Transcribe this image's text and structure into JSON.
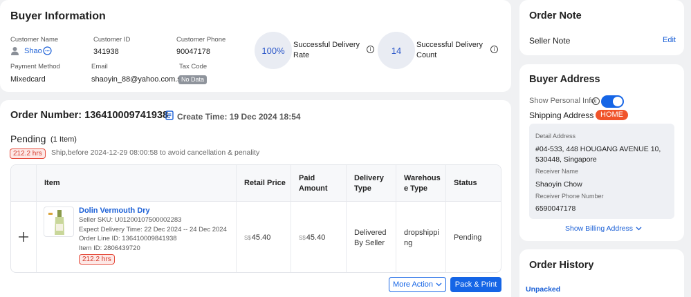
{
  "buyer_info": {
    "title": "Buyer Information",
    "customer_name_label": "Customer Name",
    "customer_name": "Shao",
    "customer_id_label": "Customer ID",
    "customer_id": "341938",
    "customer_phone_label": "Customer Phone",
    "customer_phone": "90047178",
    "delivery_rate_value": "100%",
    "delivery_rate_label_1": "Successful Delivery",
    "delivery_rate_label_2": "Rate",
    "delivery_count_value": "14",
    "delivery_count_label_1": "Successful Delivery",
    "delivery_count_label_2": "Count",
    "payment_method_label": "Payment Method",
    "payment_method": "Mixedcard",
    "email_label": "Email",
    "email": "shaoyin_88@yahoo.com.sg",
    "tax_code_label": "Tax Code",
    "tax_code": "No Data"
  },
  "order": {
    "number_label": "Order Number: 136410009741938",
    "create_time": "Create Time: 19 Dec 2024 18:54",
    "status_title": "Pending",
    "item_count": "(1 Item)",
    "warn_badge": "212.2 hrs",
    "warn_text": "Ship,before 2024-12-29 08:00:58 to avoid cancellation & penality",
    "columns": {
      "item": "Item",
      "retail_price": "Retail Price",
      "paid_1": "Paid",
      "paid_2": "Amount",
      "delivery_1": "Delivery",
      "delivery_2": "Type",
      "warehouse_1": "Warehous",
      "warehouse_2": "e Type",
      "status": "Status"
    },
    "row": {
      "product_name": "Dolin Vermouth Dry",
      "seller_sku": "Seller SKU: U01200107500002283",
      "expect_delivery": "Expect Delivery Time: 22 Dec 2024 -- 24 Dec 2024",
      "order_line_id": "Order Line ID: 136410009841938",
      "item_id": "Item ID: 2806439720",
      "hrs_badge": "212.2 hrs",
      "currency": "S$",
      "retail_price": "45.40",
      "paid_amount": "45.40",
      "delivery_1": "Delivered",
      "delivery_2": "By Seller",
      "warehouse_1": "dropshippi",
      "warehouse_2": "ng",
      "status": "Pending"
    },
    "more_action": "More Action",
    "pack_print": "Pack & Print"
  },
  "order_note": {
    "title": "Order Note",
    "seller_note": "Seller Note",
    "edit": "Edit"
  },
  "buyer_address": {
    "title": "Buyer Address",
    "show_personal_info": "Show Personal Info",
    "shipping_address": "Shipping Address",
    "home_tag": "HOME",
    "detail_label": "Detail Address",
    "detail_1": "#04-533, 448 HOUGANG AVENUE 10,",
    "detail_2": "530448, Singapore",
    "receiver_name_label": "Receiver Name",
    "receiver_name": "Shaoyin Chow",
    "receiver_phone_label": "Receiver Phone Number",
    "receiver_phone": "6590047178",
    "show_billing": "Show Billing Address"
  },
  "order_history": {
    "title": "Order History",
    "first_status": "Unpacked"
  },
  "colors": {
    "accent": "#1565e6",
    "warning": "#e54a3b",
    "home_tag": "#f0542b"
  }
}
